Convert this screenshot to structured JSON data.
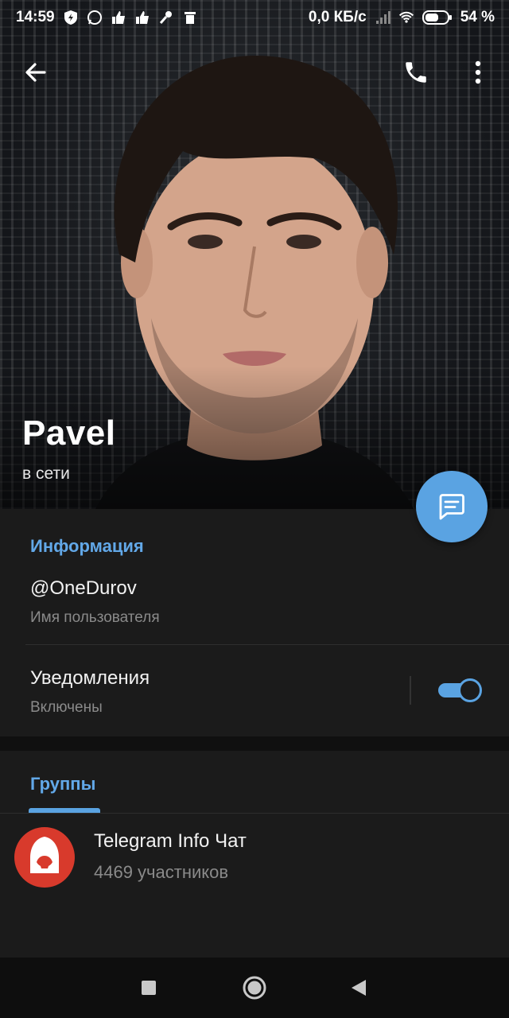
{
  "status_bar": {
    "time": "14:59",
    "network_speed": "0,0 КБ/с",
    "battery": "54 %",
    "left_icons": [
      "shield-bolt-icon",
      "whatsapp-icon",
      "vk-like-icon",
      "vk-like-icon",
      "mic-icon",
      "trash-icon"
    ],
    "right_icons": [
      "signal-icon",
      "wifi-icon",
      "battery-icon"
    ]
  },
  "action_bar": {
    "back_icon": "arrow-left-icon",
    "call_icon": "phone-icon",
    "more_icon": "more-vertical-icon"
  },
  "profile": {
    "name": "Pavel",
    "status": "в сети"
  },
  "fab": {
    "icon": "message-icon"
  },
  "info": {
    "title": "Информация",
    "username_value": "@OneDurov",
    "username_label": "Имя пользователя",
    "notifications_label": "Уведомления",
    "notifications_state": "Включены",
    "notifications_enabled": true
  },
  "groups": {
    "title": "Группы",
    "items": [
      {
        "name": "Telegram Info Чат",
        "members": "4469 участников"
      }
    ]
  },
  "colors": {
    "accent": "#5aa3e2",
    "section_title": "#62a8e8",
    "background": "#1b1b1b",
    "secondary_text": "#8a8a8a",
    "group_avatar": "#d83a2c"
  },
  "nav_bar": {
    "icons": [
      "square-icon",
      "circle-home-icon",
      "triangle-back-icon"
    ]
  }
}
